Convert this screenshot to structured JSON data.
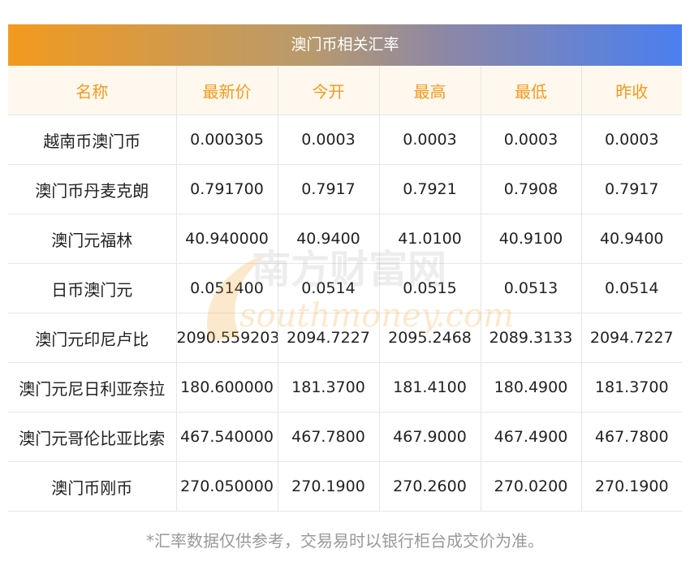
{
  "title": "澳门币相关汇率",
  "table": {
    "headers": [
      "名称",
      "最新价",
      "今开",
      "最高",
      "最低",
      "昨收"
    ],
    "rows": [
      [
        "越南币澳门币",
        "0.000305",
        "0.0003",
        "0.0003",
        "0.0003",
        "0.0003"
      ],
      [
        "澳门币丹麦克朗",
        "0.791700",
        "0.7917",
        "0.7921",
        "0.7908",
        "0.7917"
      ],
      [
        "澳门元福林",
        "40.940000",
        "40.9400",
        "41.0100",
        "40.9100",
        "40.9400"
      ],
      [
        "日币澳门元",
        "0.051400",
        "0.0514",
        "0.0515",
        "0.0513",
        "0.0514"
      ],
      [
        "澳门元印尼卢比",
        "2090.559203",
        "2094.7227",
        "2095.2468",
        "2089.3133",
        "2094.7227"
      ],
      [
        "澳门元尼日利亚奈拉",
        "180.600000",
        "181.3700",
        "181.4100",
        "180.4900",
        "181.3700"
      ],
      [
        "澳门元哥伦比亚比索",
        "467.540000",
        "467.7800",
        "467.9000",
        "467.4900",
        "467.7800"
      ],
      [
        "澳门币刚币",
        "270.050000",
        "270.1900",
        "270.2600",
        "270.0200",
        "270.1900"
      ]
    ]
  },
  "watermark": {
    "cn": "南方财富网",
    "en": "southmoney.com",
    "color": "#f39a1e"
  },
  "footnote": "*汇率数据仅供参考，交易易时以银行柜台成交价为准。",
  "colors": {
    "header_text": "#f39a1e",
    "banner_start": "#f39a1e",
    "banner_end": "#4a7ff0"
  }
}
